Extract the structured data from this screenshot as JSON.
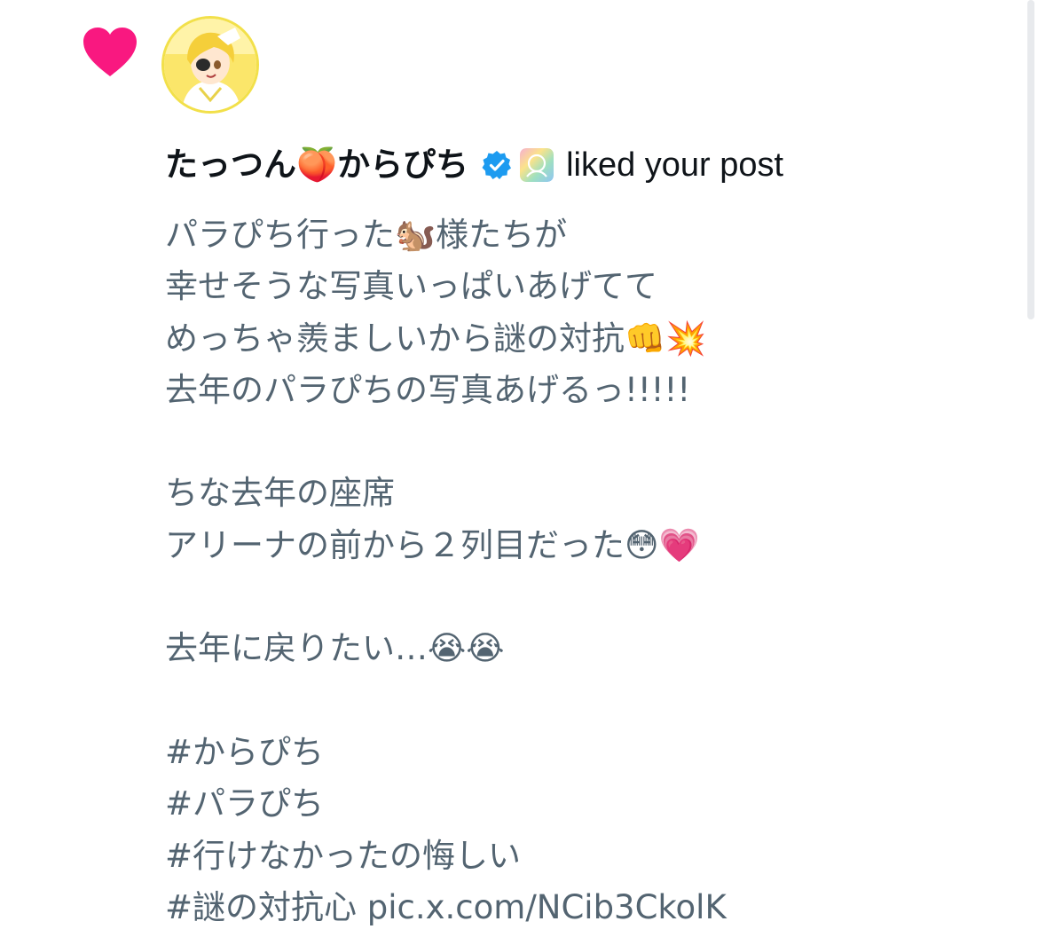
{
  "notification": {
    "type_icon": "heart-icon",
    "accent_color": "#f91880",
    "avatar_icon": "avatar",
    "user_name": "たっつん🍑からぴち",
    "verified_icon": "verified-badge-icon",
    "affiliate_icon": "affiliate-badge-icon",
    "action_text": "liked your post",
    "post_text": "パラぴち行った🐿️様たちが\n幸せそうな写真いっぱいあげてて\nめっちゃ羨ましいから謎の対抗👊💥\n去年のパラぴちの写真あげるっ!!!!!\n\nちな去年の座席\nアリーナの前から２列目だった😳💗\n\n去年に戻りたい…😭😭\n\n#からぴち\n#パラぴち\n#行けなかったの悔しい\n#謎の対抗心 pic.x.com/NCib3CkolK"
  },
  "colors": {
    "text_primary": "#0f1419",
    "text_secondary": "#536471",
    "verified": "#1d9bf0"
  }
}
